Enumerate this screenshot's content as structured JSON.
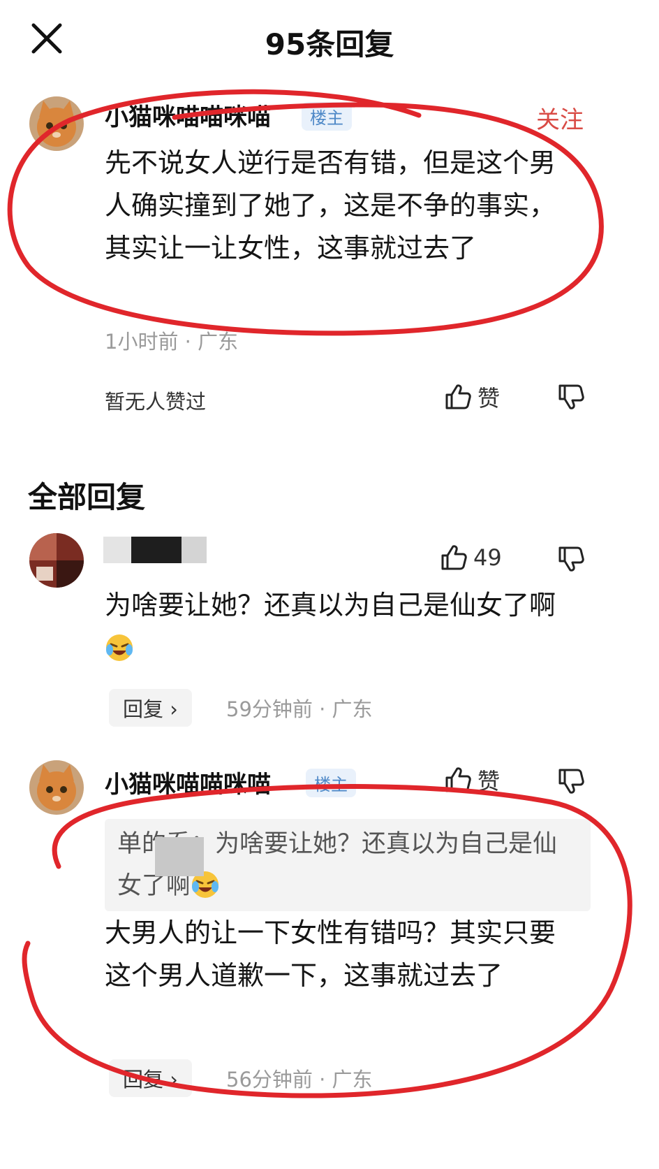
{
  "header": {
    "title": "95条回复"
  },
  "main_comment": {
    "username": "小猫咪喵喵咪喵",
    "badge": "楼主",
    "follow": "关注",
    "text": "先不说女人逆行是否有错，但是这个男人确实撞到了她了，这是不争的事实，其实让一让女性，这事就过去了",
    "time_location": "1小时前 · 广东",
    "no_likes": "暂无人赞过",
    "like_label": "赞"
  },
  "section": {
    "title": "全部回复"
  },
  "replies": [
    {
      "username_visible_fragment": "\u0000",
      "like_count": "49",
      "text": "为啥要让她？还真以为自己是仙女了啊",
      "reply_label": "回复 ›",
      "time_location": "59分钟前 · 广东"
    },
    {
      "username": "小猫咪喵喵咪喵",
      "badge": "楼主",
      "like_label": "赞",
      "quote": "单的乔：为啥要让她？还真以为自己是仙女了啊",
      "text": "大男人的让一下女性有错吗？其实只要这个男人道歉一下，这事就过去了",
      "reply_label": "回复 ›",
      "time_location": "56分钟前 · 广东"
    }
  ],
  "colors": {
    "accent_red": "#d94b45",
    "badge_blue": "#4e88c7",
    "annotation_red": "#e0262b"
  },
  "icons": [
    "close-icon",
    "thumb-up-icon",
    "thumb-down-icon",
    "laughing-crying-emoji"
  ]
}
